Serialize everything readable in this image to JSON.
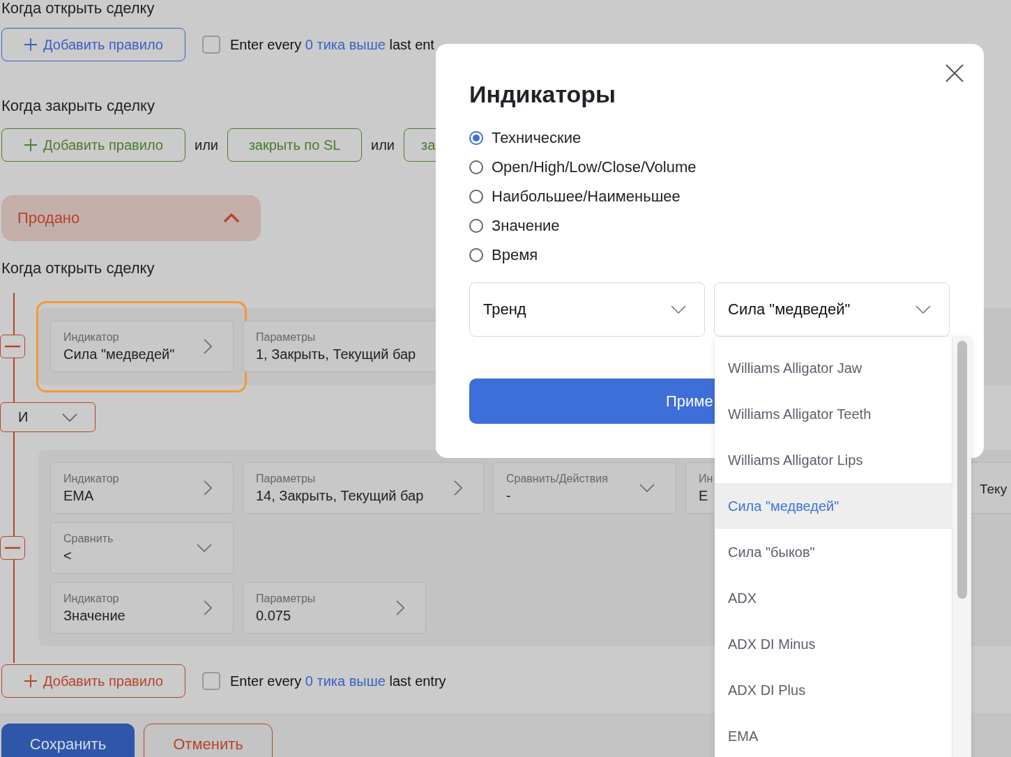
{
  "sections": [
    {
      "heading": "Когда открыть сделку",
      "color": "#3a5fc0",
      "add_button": "Добавить правило",
      "checkbox": {
        "checked": false,
        "prefix": "Enter every",
        "link": "0 тика выше",
        "suffix": "last ent"
      }
    },
    {
      "heading": "Когда закрыть сделку",
      "color": "#4b7a2c",
      "add_button": "Добавить правило",
      "alternatives": [
        {
          "separator": "или",
          "label": "закрыть по SL"
        },
        {
          "separator": "или",
          "label": "за"
        }
      ]
    }
  ],
  "collapsible": {
    "label": "Продано",
    "expanded": true,
    "color": "#b5432a"
  },
  "sold": {
    "heading": "Когда открыть сделку",
    "color": "#b5432a",
    "groups": [
      {
        "rows": [
          [
            {
              "kind": "nav",
              "label": "Индикатор",
              "value": "Сила \"медведей\"",
              "highlighted": true
            },
            {
              "kind": "cut",
              "label": "Параметры",
              "value": "1, Закрыть, Текущий бар",
              "highlighted": false
            }
          ]
        ]
      },
      {
        "rows": [
          [
            {
              "kind": "nav",
              "label": "Индикатор",
              "value": "EMA",
              "highlighted": false
            },
            {
              "kind": "nav",
              "label": "Параметры",
              "value": "14, Закрыть, Текущий бар",
              "highlighted": false
            },
            {
              "kind": "select",
              "label": "Сравнить/Действия",
              "value": "-",
              "highlighted": false
            },
            {
              "kind": "cut",
              "label": "Ин",
              "value": "E",
              "highlighted": false
            },
            {
              "kind": "gap"
            },
            {
              "kind": "tail",
              "value": "Теку"
            }
          ],
          [
            {
              "kind": "select",
              "label": "Сравнить",
              "value": "<",
              "highlighted": false
            }
          ],
          [
            {
              "kind": "nav",
              "label": "Индикатор",
              "value": "Значение",
              "highlighted": false
            },
            {
              "kind": "nav",
              "label": "Параметры",
              "value": "0.075",
              "highlighted": false
            }
          ]
        ]
      }
    ],
    "joiner": "И",
    "add_button": "Добавить правило",
    "checkbox": {
      "checked": false,
      "prefix": "Enter every",
      "link": "0 тика выше",
      "suffix": "last entry"
    }
  },
  "footer": {
    "save": "Сохранить",
    "cancel": "Отменить"
  },
  "modal": {
    "title": "Индикаторы",
    "options": [
      {
        "label": "Технические",
        "selected": true
      },
      {
        "label": "Open/High/Low/Close/Volume",
        "selected": false
      },
      {
        "label": "Наибольшее/Наименьшее",
        "selected": false
      },
      {
        "label": "Значение",
        "selected": false
      },
      {
        "label": "Время",
        "selected": false
      }
    ],
    "selects": [
      {
        "value": "Тренд"
      },
      {
        "value": "Сила \"медведей\""
      }
    ],
    "apply": "Приме",
    "dropdown": [
      {
        "label": "Williams Alligator Jaw",
        "selected": false
      },
      {
        "label": "Williams Alligator Teeth",
        "selected": false
      },
      {
        "label": "Williams Alligator Lips",
        "selected": false
      },
      {
        "label": "Сила \"медведей\"",
        "selected": true
      },
      {
        "label": "Сила \"быков\"",
        "selected": false
      },
      {
        "label": "ADX",
        "selected": false
      },
      {
        "label": "ADX DI Minus",
        "selected": false
      },
      {
        "label": "ADX DI Plus",
        "selected": false
      },
      {
        "label": "EMA",
        "selected": false
      }
    ]
  }
}
